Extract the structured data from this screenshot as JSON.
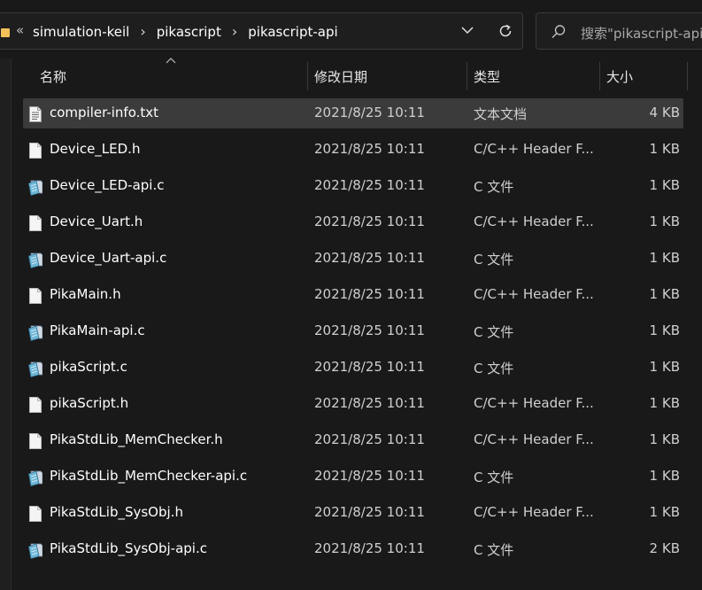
{
  "address_bar": {
    "overflow": "«",
    "breadcrumbs": [
      "simulation-keil",
      "pikascript",
      "pikascript-api"
    ]
  },
  "search": {
    "placeholder": "搜索\"pikascript-api\""
  },
  "columns": {
    "name": "名称",
    "date": "修改日期",
    "type": "类型",
    "size": "大小"
  },
  "files": [
    {
      "name": "compiler-info.txt",
      "date": "2021/8/25 10:11",
      "type": "文本文档",
      "size": "4 KB",
      "icon": "text-file-icon",
      "selected": true
    },
    {
      "name": "Device_LED.h",
      "date": "2021/8/25 10:11",
      "type": "C/C++ Header F...",
      "size": "1 KB",
      "icon": "blank-file-icon"
    },
    {
      "name": "Device_LED-api.c",
      "date": "2021/8/25 10:11",
      "type": "C 文件",
      "size": "1 KB",
      "icon": "c-file-icon"
    },
    {
      "name": "Device_Uart.h",
      "date": "2021/8/25 10:11",
      "type": "C/C++ Header F...",
      "size": "1 KB",
      "icon": "blank-file-icon"
    },
    {
      "name": "Device_Uart-api.c",
      "date": "2021/8/25 10:11",
      "type": "C 文件",
      "size": "1 KB",
      "icon": "c-file-icon"
    },
    {
      "name": "PikaMain.h",
      "date": "2021/8/25 10:11",
      "type": "C/C++ Header F...",
      "size": "1 KB",
      "icon": "blank-file-icon"
    },
    {
      "name": "PikaMain-api.c",
      "date": "2021/8/25 10:11",
      "type": "C 文件",
      "size": "1 KB",
      "icon": "c-file-icon"
    },
    {
      "name": "pikaScript.c",
      "date": "2021/8/25 10:11",
      "type": "C 文件",
      "size": "1 KB",
      "icon": "c-file-icon"
    },
    {
      "name": "pikaScript.h",
      "date": "2021/8/25 10:11",
      "type": "C/C++ Header F...",
      "size": "1 KB",
      "icon": "blank-file-icon"
    },
    {
      "name": "PikaStdLib_MemChecker.h",
      "date": "2021/8/25 10:11",
      "type": "C/C++ Header F...",
      "size": "1 KB",
      "icon": "blank-file-icon"
    },
    {
      "name": "PikaStdLib_MemChecker-api.c",
      "date": "2021/8/25 10:11",
      "type": "C 文件",
      "size": "1 KB",
      "icon": "c-file-icon"
    },
    {
      "name": "PikaStdLib_SysObj.h",
      "date": "2021/8/25 10:11",
      "type": "C/C++ Header F...",
      "size": "1 KB",
      "icon": "blank-file-icon"
    },
    {
      "name": "PikaStdLib_SysObj-api.c",
      "date": "2021/8/25 10:11",
      "type": "C 文件",
      "size": "2 KB",
      "icon": "c-file-icon"
    }
  ],
  "colors": {
    "background": "#191919",
    "selection": "#3b3b3b",
    "folder": "#f2c15a"
  }
}
